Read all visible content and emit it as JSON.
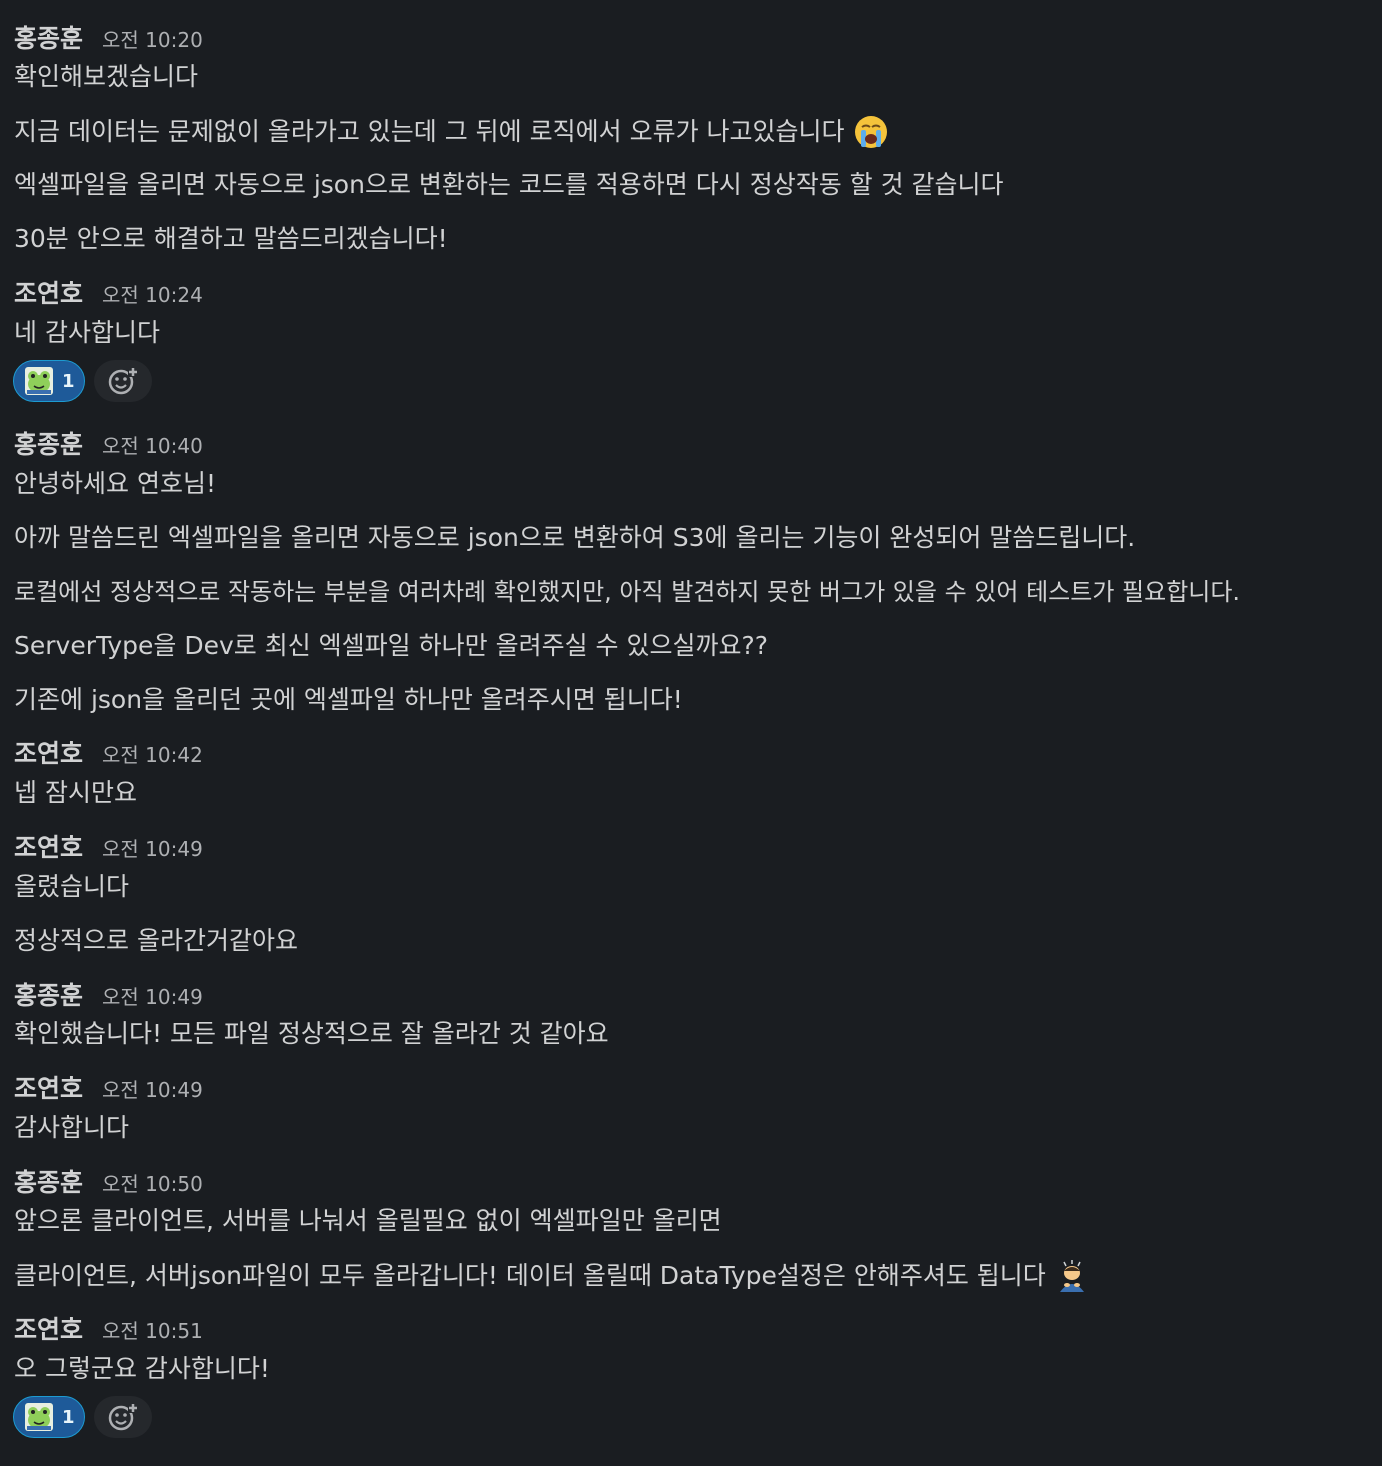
{
  "messages": [
    {
      "author": "홍종훈",
      "time": "오전 10:20",
      "lines": [
        "확인해보겠습니다",
        "지금 데이터는 문제없이 올라가고 있는데 그 뒤에 로직에서 오류가 나고있습니다",
        "엑셀파일을 올리면 자동으로 json으로 변환하는 코드를 적용하면 다시 정상작동 할 것 같습니다",
        "30분 안으로 해결하고 말씀드리겠습니다!"
      ],
      "emoji_line_1": "sob-emoji"
    },
    {
      "author": "조연호",
      "time": "오전 10:24",
      "lines": [
        "네 감사합니다"
      ],
      "reaction": {
        "emoji": "custom-frog-emoji",
        "count": "1"
      }
    },
    {
      "author": "홍종훈",
      "time": "오전 10:40",
      "lines": [
        "안녕하세요 연호님!",
        "아까 말씀드린 엑셀파일을 올리면 자동으로 json으로 변환하여 S3에 올리는 기능이 완성되어 말씀드립니다.",
        "로컬에선 정상적으로 작동하는 부분을 여러차례 확인했지만, 아직 발견하지 못한 버그가 있을 수 있어 테스트가 필요합니다.",
        "ServerType을 Dev로 최신 엑셀파일 하나만 올려주실 수 있으실까요??",
        "기존에 json을 올리던 곳에 엑셀파일 하나만 올려주시면 됩니다!"
      ]
    },
    {
      "author": "조연호",
      "time": "오전 10:42",
      "lines": [
        "넵 잠시만요"
      ]
    },
    {
      "author": "조연호",
      "time": "오전 10:49",
      "lines": [
        "올렸습니다",
        "정상적으로 올라간거같아요"
      ]
    },
    {
      "author": "홍종훈",
      "time": "오전 10:49",
      "lines": [
        "확인했습니다! 모든 파일 정상적으로 잘 올라간 것 같아요"
      ]
    },
    {
      "author": "조연호",
      "time": "오전 10:49",
      "lines": [
        "감사합니다"
      ]
    },
    {
      "author": "홍종훈",
      "time": "오전 10:50",
      "lines": [
        "앞으론 클라이언트, 서버를 나눠서 올릴필요 없이 엑셀파일만 올리면",
        "클라이언트, 서버json파일이 모두 올라갑니다!  데이터 올릴때 DataType설정은 안해주셔도 됩니다"
      ],
      "emoji_line_1": "bowing-person-emoji"
    },
    {
      "author": "조연호",
      "time": "오전 10:51",
      "lines": [
        "오 그렇군요 감사합니다!"
      ],
      "reaction": {
        "emoji": "custom-frog-emoji",
        "count": "1"
      }
    }
  ]
}
